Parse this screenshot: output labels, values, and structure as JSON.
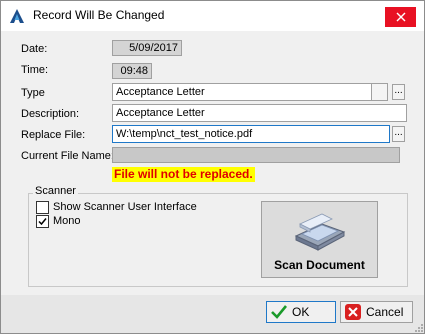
{
  "window": {
    "title": "Record Will Be Changed"
  },
  "fields": {
    "date": {
      "label": "Date:",
      "value": "5/09/2017"
    },
    "time": {
      "label": "Time:",
      "value": "09:48"
    },
    "type": {
      "label": "Type",
      "value": "Acceptance Letter"
    },
    "description": {
      "label": "Description:",
      "value": "Acceptance Letter"
    },
    "replace_file": {
      "label": "Replace File:",
      "value": "W:\\temp\\nct_test_notice.pdf"
    },
    "current_file": {
      "label": "Current File Name:",
      "value": ""
    }
  },
  "warning": "File will not be replaced.",
  "scanner": {
    "legend": "Scanner",
    "show_ui": {
      "label": "Show Scanner User Interface",
      "checked": false
    },
    "mono": {
      "label": "Mono",
      "checked": true
    },
    "scan_button": "Scan Document"
  },
  "buttons": {
    "ok": "OK",
    "cancel": "Cancel"
  },
  "ellipsis": "...",
  "colors": {
    "warning_bg": "#ffff00",
    "warning_text": "#e00000",
    "close_bg": "#e81123",
    "focus_border": "#1f78c8"
  }
}
